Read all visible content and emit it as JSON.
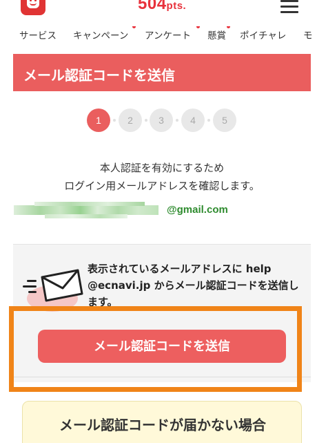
{
  "header": {
    "points_value": "504",
    "points_unit": "pts."
  },
  "nav": {
    "items": [
      {
        "label": "サービス",
        "dot": false
      },
      {
        "label": "キャンペーン",
        "dot": true
      },
      {
        "label": "アンケート",
        "dot": true
      },
      {
        "label": "懸賞",
        "dot": true
      },
      {
        "label": "ポイチャレ",
        "dot": false
      },
      {
        "label": "モ",
        "dot": false
      }
    ]
  },
  "page": {
    "title": "メール認証コードを送信"
  },
  "steps": {
    "items": [
      "1",
      "2",
      "3",
      "4",
      "5"
    ],
    "current": 1
  },
  "description": {
    "line1": "本人認証を有効にするため",
    "line2": "ログイン用メールアドレスを確認します。"
  },
  "email": {
    "domain": "@gmail.com"
  },
  "info": {
    "text": "表示されているメールアドレスに help @ecnavi.jp からメール認証コードを送信します。"
  },
  "actions": {
    "send_label": "メール認証コードを送信"
  },
  "help": {
    "not_received_title": "メール認証コードが届かない場合"
  },
  "colors": {
    "accent": "#ea5e5e",
    "brand": "#e8323c",
    "highlight": "#f08418",
    "email_green": "#2e8b2e"
  }
}
